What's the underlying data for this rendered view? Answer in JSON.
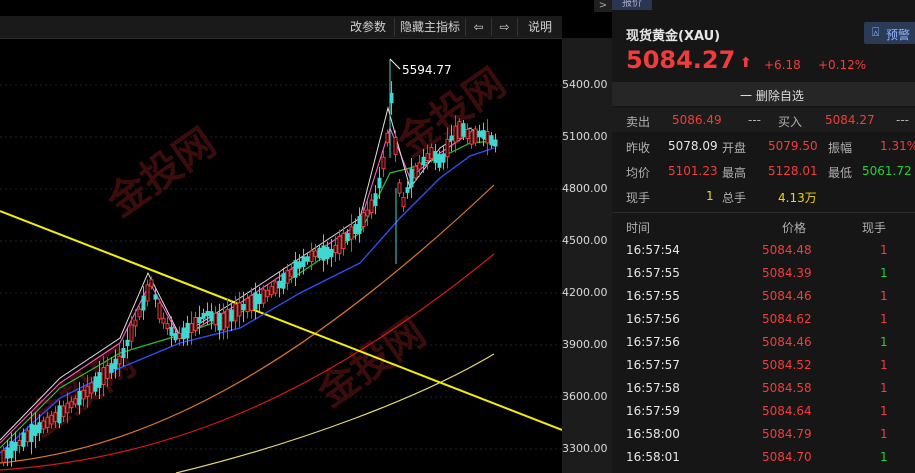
{
  "toolbar": {
    "params": "改参数",
    "hide_indicator": "隐藏主指标",
    "prev": "⇦",
    "next": "⇨",
    "help": "说明",
    "expand": ">"
  },
  "chart": {
    "peak_label": "5594.77",
    "y_ticks": [
      "5400.00",
      "5100.00",
      "4800.00",
      "4500.00",
      "4200.00",
      "3900.00",
      "3600.00",
      "3300.00"
    ],
    "watermark": "金投网 JT.CN"
  },
  "chart_data": {
    "type": "candlestick",
    "y_axis_ticks": [
      5400,
      5100,
      4800,
      4500,
      4200,
      3900,
      3600,
      3300
    ],
    "peak_high": 5594.77
  },
  "quote": {
    "tab": "报价",
    "name": "现货黄金(XAU)",
    "price": "5084.27",
    "arrow": "⬆",
    "change": "+6.18",
    "change_pct": "+0.12%",
    "alert": "预警",
    "remove_watch": "一 删除自选",
    "sell_label": "卖出",
    "sell_value": "5086.49",
    "sell_vol": "---",
    "buy_label": "买入",
    "buy_value": "5084.27",
    "buy_vol": "---",
    "prev_close_label": "昨收",
    "prev_close": "5078.09",
    "open_label": "开盘",
    "open": "5079.50",
    "amplitude_label": "振幅",
    "amplitude": "1.31%",
    "avg_label": "均价",
    "avg": "5101.23",
    "high_label": "最高",
    "high": "5128.01",
    "low_label": "最低",
    "low": "5061.72",
    "cur_vol_label": "现手",
    "cur_vol": "1",
    "total_vol_label": "总手",
    "total_vol": "4.13万"
  },
  "trades": {
    "headers": [
      "时间",
      "价格",
      "现手"
    ],
    "rows": [
      {
        "time": "16:57:54",
        "price": "5084.48",
        "vol": "1",
        "vol_color": "red"
      },
      {
        "time": "16:57:55",
        "price": "5084.39",
        "vol": "1",
        "vol_color": "green"
      },
      {
        "time": "16:57:55",
        "price": "5084.46",
        "vol": "1",
        "vol_color": "red"
      },
      {
        "time": "16:57:56",
        "price": "5084.62",
        "vol": "1",
        "vol_color": "red"
      },
      {
        "time": "16:57:56",
        "price": "5084.46",
        "vol": "1",
        "vol_color": "green"
      },
      {
        "time": "16:57:57",
        "price": "5084.52",
        "vol": "1",
        "vol_color": "red"
      },
      {
        "time": "16:57:58",
        "price": "5084.58",
        "vol": "1",
        "vol_color": "red"
      },
      {
        "time": "16:57:59",
        "price": "5084.64",
        "vol": "1",
        "vol_color": "red"
      },
      {
        "time": "16:58:00",
        "price": "5084.79",
        "vol": "1",
        "vol_color": "red"
      },
      {
        "time": "16:58:01",
        "price": "5084.70",
        "vol": "1",
        "vol_color": "green"
      }
    ]
  },
  "colors": {
    "up": "#f23c3c",
    "down": "#1fd13f",
    "accent": "#f5d200"
  }
}
